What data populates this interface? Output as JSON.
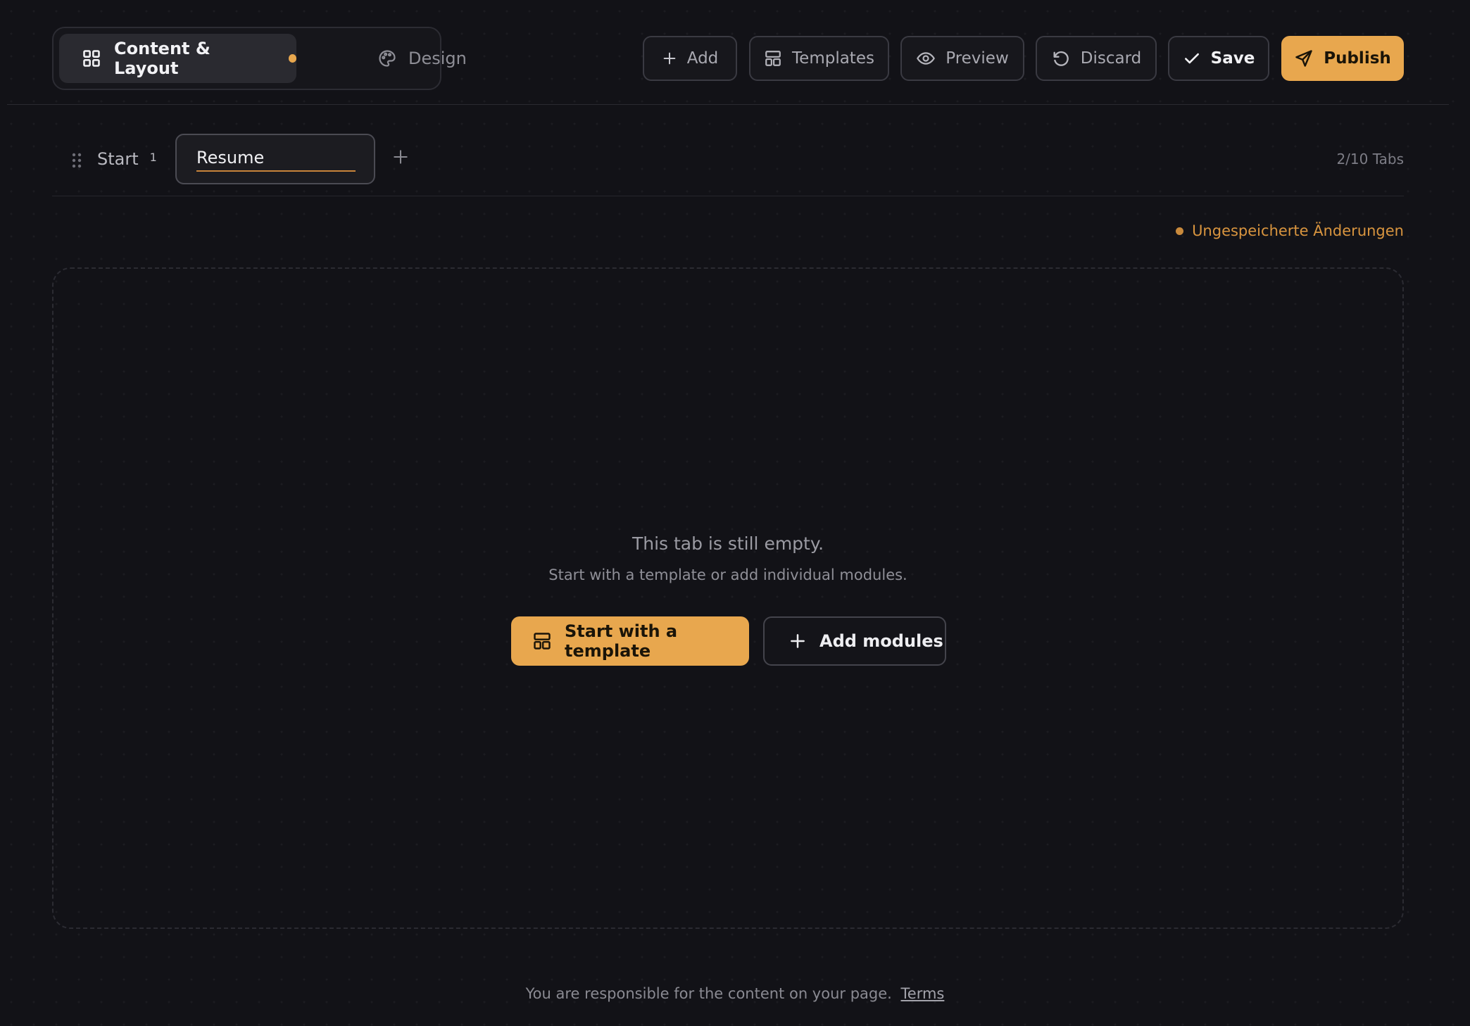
{
  "header": {
    "mode_tabs": [
      {
        "label": "Content & Layout",
        "icon": "layout-grid-icon",
        "active": true,
        "unsaved_dot": true
      },
      {
        "label": "Design",
        "icon": "palette-icon",
        "active": false
      }
    ],
    "toolbar": {
      "add_label": "Add",
      "templates_label": "Templates",
      "preview_label": "Preview",
      "discard_label": "Discard",
      "save_label": "Save",
      "publish_label": "Publish"
    }
  },
  "tabs": {
    "items": [
      {
        "label": "Start",
        "count": "1"
      },
      {
        "label": "Resume",
        "editing": true
      }
    ],
    "counter": "2/10 Tabs"
  },
  "status": {
    "unsaved_text": "Ungespeicherte Änderungen"
  },
  "empty_state": {
    "title": "This tab is still empty.",
    "subtitle": "Start with a template or add individual modules.",
    "primary_label": "Start with a template",
    "secondary_label": "Add modules"
  },
  "footer": {
    "text": "You are responsible for the content on your page.",
    "link_label": "Terms"
  },
  "colors": {
    "background": "#121217",
    "accent": "#e8a74e",
    "unsaved": "#d9953f"
  }
}
